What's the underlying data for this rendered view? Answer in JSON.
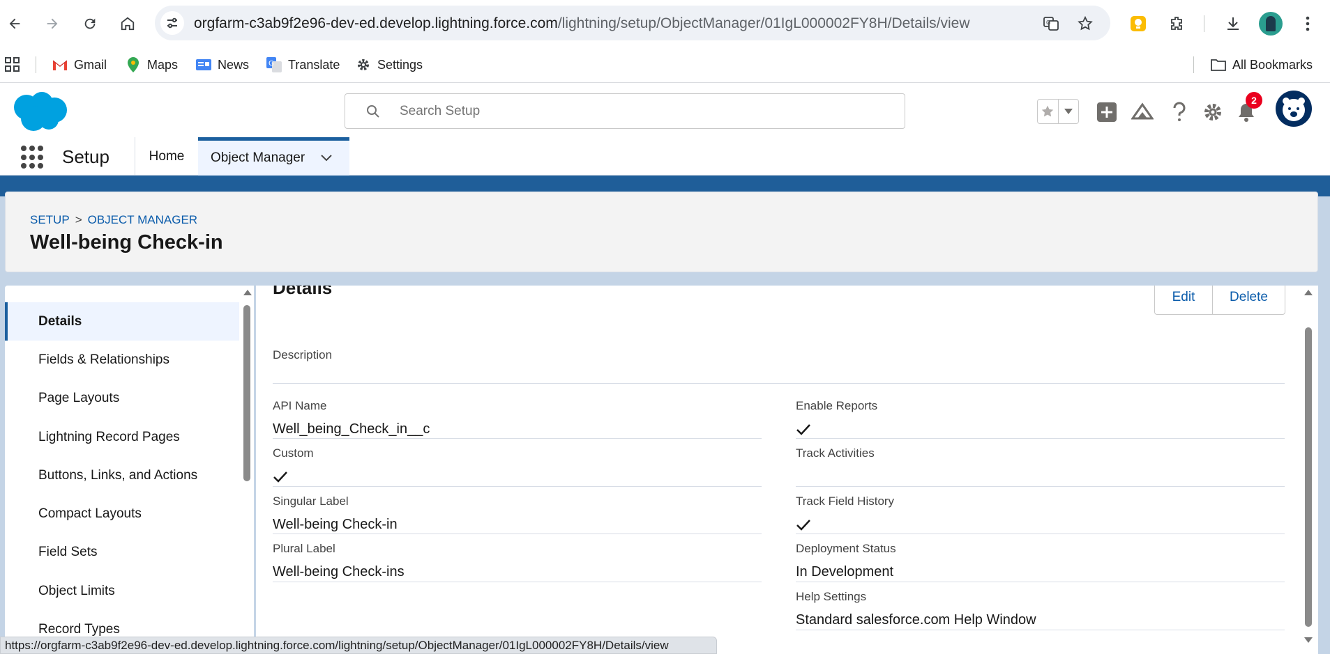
{
  "browser": {
    "url_host": "orgfarm-c3ab9f2e96-dev-ed.develop.lightning.force.com",
    "url_path": "/lightning/setup/ObjectManager/01IgL000002FY8H/Details/view",
    "bookmarks": [
      "Gmail",
      "Maps",
      "News",
      "Translate",
      "Settings"
    ],
    "all_bookmarks": "All Bookmarks",
    "status_url": "https://orgfarm-c3ab9f2e96-dev-ed.develop.lightning.force.com/lightning/setup/ObjectManager/01IgL000002FY8H/Details/view"
  },
  "header": {
    "search_placeholder": "Search Setup",
    "notification_count": "2"
  },
  "app_nav": {
    "app_name": "Setup",
    "tabs": [
      "Home",
      "Object Manager"
    ]
  },
  "page": {
    "breadcrumb": [
      "SETUP",
      "OBJECT MANAGER"
    ],
    "breadcrumb_sep": ">",
    "title": "Well-being Check-in"
  },
  "sidebar": {
    "items": [
      "Details",
      "Fields & Relationships",
      "Page Layouts",
      "Lightning Record Pages",
      "Buttons, Links, and Actions",
      "Compact Layouts",
      "Field Sets",
      "Object Limits",
      "Record Types"
    ]
  },
  "details": {
    "section_title": "Details",
    "edit_label": "Edit",
    "delete_label": "Delete",
    "description_label": "Description",
    "api_name_label": "API Name",
    "api_name_value": "Well_being_Check_in__c",
    "custom_label": "Custom",
    "singular_label_label": "Singular Label",
    "singular_label_value": "Well-being Check-in",
    "plural_label_label": "Plural Label",
    "plural_label_value": "Well-being Check-ins",
    "enable_reports_label": "Enable Reports",
    "track_activities_label": "Track Activities",
    "track_field_history_label": "Track Field History",
    "deployment_status_label": "Deployment Status",
    "deployment_status_value": "In Development",
    "help_settings_label": "Help Settings",
    "help_settings_value": "Standard salesforce.com Help Window"
  },
  "colors": {
    "brand_blue": "#1f5e99",
    "link_blue": "#0b5cab",
    "salesforce_cloud": "#00a1e0"
  }
}
